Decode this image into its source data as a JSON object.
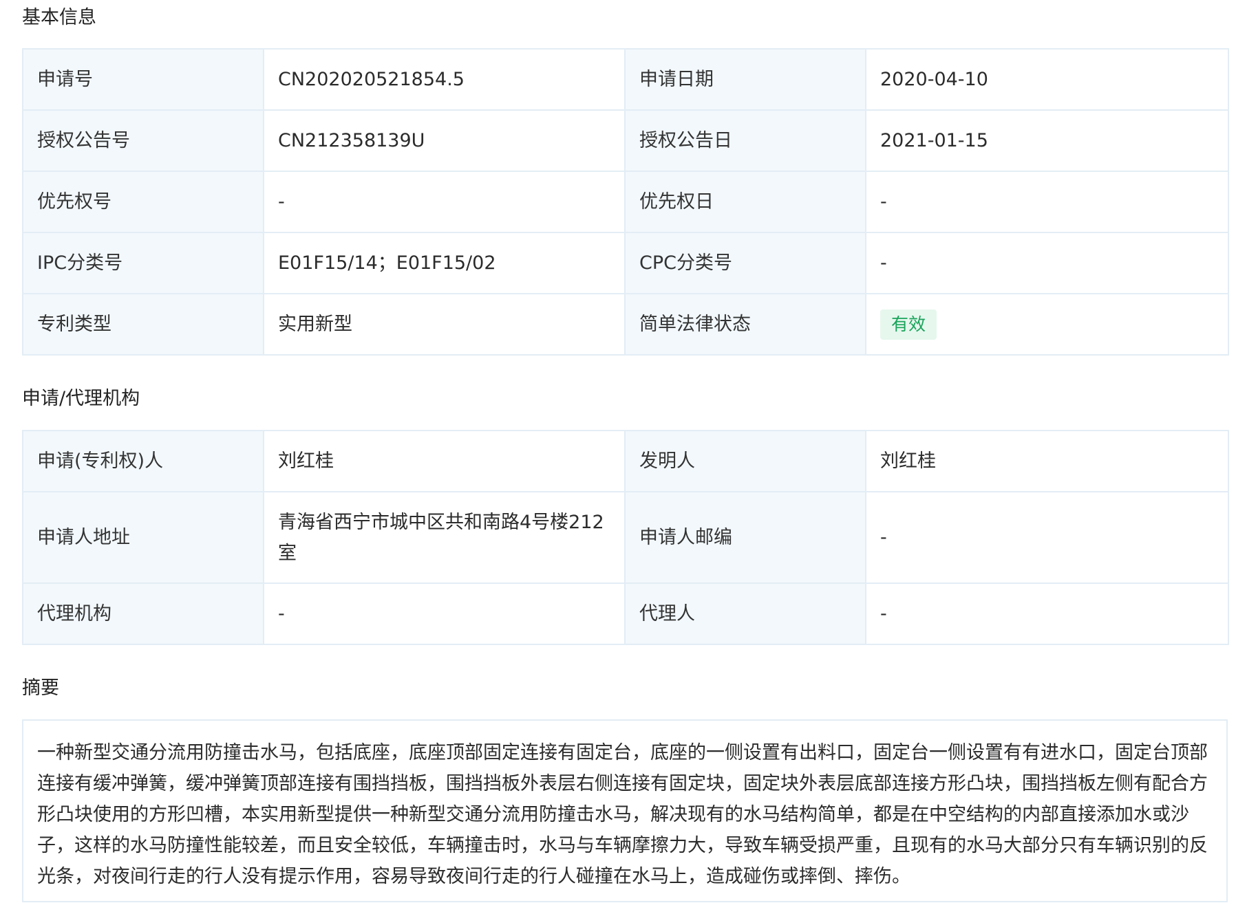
{
  "basic_info": {
    "title": "基本信息",
    "rows": [
      {
        "l1": "申请号",
        "v1": "CN202020521854.5",
        "l2": "申请日期",
        "v2": "2020-04-10"
      },
      {
        "l1": "授权公告号",
        "v1": "CN212358139U",
        "l2": "授权公告日",
        "v2": "2021-01-15"
      },
      {
        "l1": "优先权号",
        "v1": "-",
        "l2": "优先权日",
        "v2": "-"
      },
      {
        "l1": "IPC分类号",
        "v1": "E01F15/14；E01F15/02",
        "l2": "CPC分类号",
        "v2": "-"
      },
      {
        "l1": "专利类型",
        "v1": "实用新型",
        "l2": "简单法律状态",
        "v2": "有效"
      }
    ],
    "status_color": "#1aa35a"
  },
  "agency": {
    "title": "申请/代理机构",
    "rows": [
      {
        "l1": "申请(专利权)人",
        "v1": "刘红桂",
        "l2": "发明人",
        "v2": "刘红桂"
      },
      {
        "l1": "申请人地址",
        "v1": "青海省西宁市城中区共和南路4号楼212室",
        "l2": "申请人邮编",
        "v2": "-"
      },
      {
        "l1": "代理机构",
        "v1": "-",
        "l2": "代理人",
        "v2": "-"
      }
    ]
  },
  "abstract": {
    "title": "摘要",
    "text": "一种新型交通分流用防撞击水马，包括底座，底座顶部固定连接有固定台，底座的一侧设置有出料口，固定台一侧设置有有进水口，固定台顶部连接有缓冲弹簧，缓冲弹簧顶部连接有围挡挡板，围挡挡板外表层右侧连接有固定块，固定块外表层底部连接方形凸块，围挡挡板左侧有配合方形凸块使用的方形凹槽，本实用新型提供一种新型交通分流用防撞击水马，解决现有的水马结构简单，都是在中空结构的内部直接添加水或沙子，这样的水马防撞性能较差，而且安全较低，车辆撞击时，水马与车辆摩擦力大，导致车辆受损严重，且现有的水马大部分只有车辆识别的反光条，对夜间行走的行人没有提示作用，容易导致夜间行走的行人碰撞在水马上，造成碰伤或摔倒、摔伤。"
  }
}
